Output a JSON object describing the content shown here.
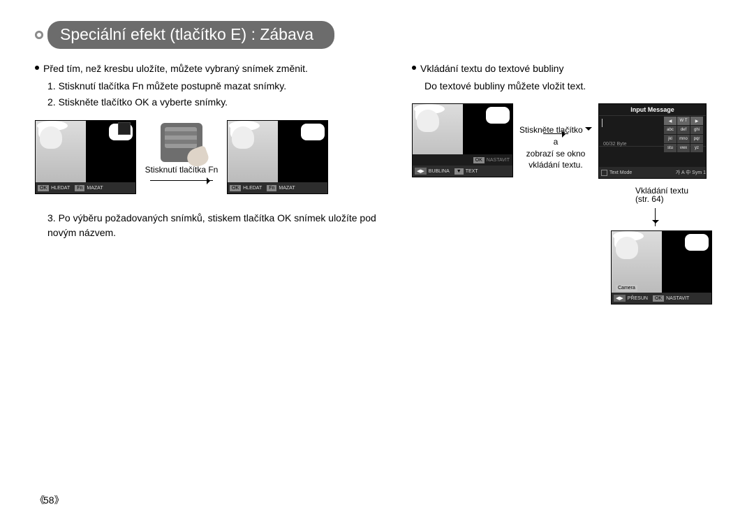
{
  "page": {
    "title": "Speciální efekt (tlačítko E) : Zábava",
    "number": "58"
  },
  "left": {
    "lead": "Před tím, než kresbu uložíte, můžete vybraný snímek změnit.",
    "step1": "1. Stisknutí tlačítka Fn můžete postupně mazat snímky.",
    "step2": "2. Stiskněte tlačítko OK a vyberte snímky.",
    "between_caption": "Stisknutí tlačítka Fn",
    "step3": "3. Po výběru požadovaných snímků, stiskem tlačítka OK snímek uložíte pod novým názvem.",
    "lcd": {
      "ok": "OK",
      "ok_label": "HLEDAT",
      "fn": "Fn",
      "fn_label": "MAZAT"
    }
  },
  "right": {
    "lead": "Vkládání textu do textové bubliny",
    "sub": "Do textové bubliny můžete vložit text.",
    "mid_line1": "Stiskněte tlačítko ",
    "mid_line1b": " a",
    "mid_line2": "zobrazí se okno",
    "mid_line3": "vkládání textu.",
    "lcd1": {
      "arrows": "◀▶",
      "l_label": "BUBLINA",
      "ok": "OK",
      "ok_label": "NASTAVIT",
      "text_btn": "▼",
      "text_label": "TEXT"
    },
    "input_panel": {
      "title": "Input Message",
      "nav": "◀ W T ▶",
      "byte": "00/32 Byte",
      "keys_r1": [
        "abc",
        "def",
        "ghi"
      ],
      "keys_r2": [
        "jkl",
        "mno",
        "pqr"
      ],
      "keys_r3": [
        "stu",
        "vwx",
        "yz"
      ],
      "bot_label": "Text Mode",
      "bot_right": "가 A 中 Sym 1"
    },
    "down_caption1": "Vkládání textu",
    "down_caption2": "(str. 64)",
    "lcd2": {
      "camera": "Camera",
      "arrows": "◀▶",
      "l_label": "PŘESUN",
      "ok": "OK",
      "ok_label": "NASTAVIT"
    }
  }
}
